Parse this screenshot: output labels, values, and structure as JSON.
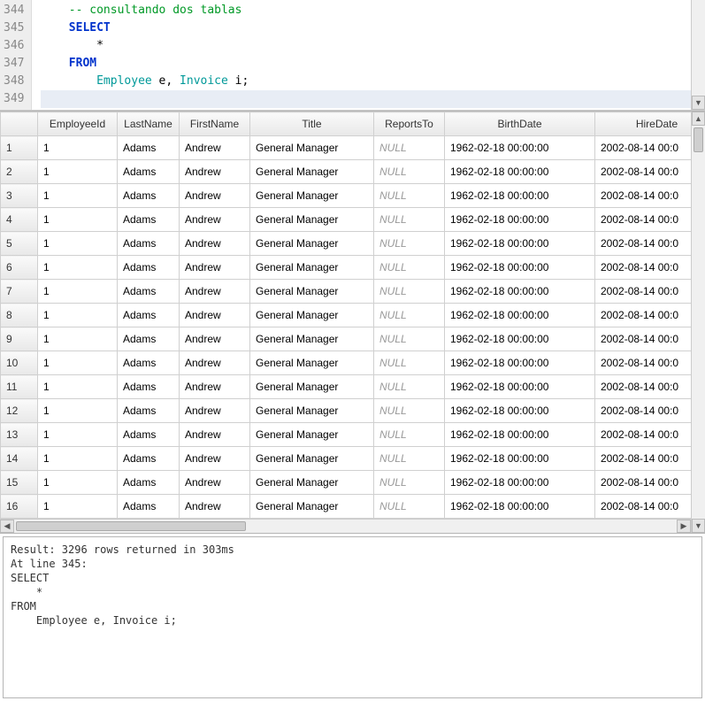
{
  "editor": {
    "lines": [
      {
        "num": "344",
        "tokens": [
          {
            "t": "    ",
            "c": ""
          },
          {
            "t": "-- consultando dos tablas",
            "c": "tok-comment"
          }
        ]
      },
      {
        "num": "345",
        "tokens": [
          {
            "t": "    ",
            "c": ""
          },
          {
            "t": "SELECT",
            "c": "tok-keyword"
          }
        ]
      },
      {
        "num": "346",
        "tokens": [
          {
            "t": "        *",
            "c": ""
          }
        ]
      },
      {
        "num": "347",
        "tokens": [
          {
            "t": "    ",
            "c": ""
          },
          {
            "t": "FROM",
            "c": "tok-keyword"
          }
        ]
      },
      {
        "num": "348",
        "tokens": [
          {
            "t": "        ",
            "c": ""
          },
          {
            "t": "Employee",
            "c": "tok-ident"
          },
          {
            "t": " e, ",
            "c": ""
          },
          {
            "t": "Invoice",
            "c": "tok-ident"
          },
          {
            "t": " i;",
            "c": ""
          }
        ]
      },
      {
        "num": "349",
        "tokens": [],
        "current": true
      }
    ]
  },
  "results": {
    "columns": [
      "EmployeeId",
      "LastName",
      "FirstName",
      "Title",
      "ReportsTo",
      "BirthDate",
      "HireDate"
    ],
    "row_count": 16,
    "template_row": {
      "EmployeeId": "1",
      "LastName": "Adams",
      "FirstName": "Andrew",
      "Title": "General Manager",
      "ReportsTo": null,
      "BirthDate": "1962-02-18 00:00:00",
      "HireDate": "2002-08-14 00:0"
    },
    "null_label": "NULL"
  },
  "output": {
    "text": "Result: 3296 rows returned in 303ms\nAt line 345:\nSELECT\n    *\nFROM\n    Employee e, Invoice i;"
  }
}
